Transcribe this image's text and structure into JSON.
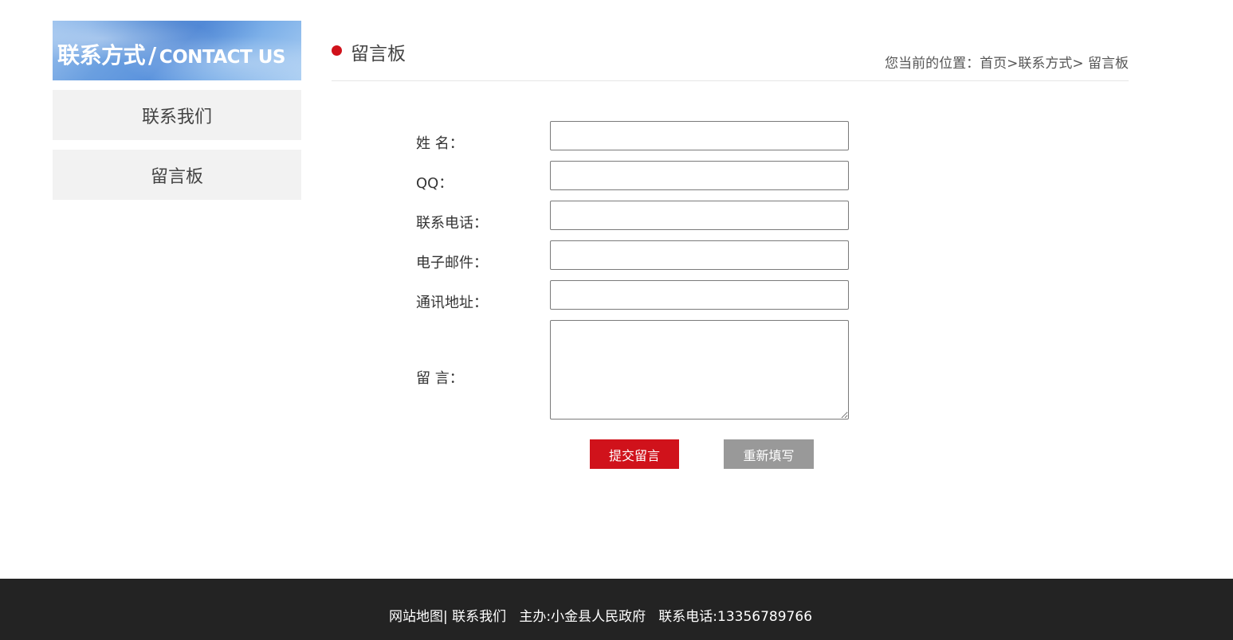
{
  "sidebar": {
    "banner_cn": "联系方式",
    "banner_sep": "/",
    "banner_en": "CONTACT US",
    "items": [
      {
        "label": "联系我们"
      },
      {
        "label": "留言板"
      }
    ]
  },
  "header": {
    "title": "留言板",
    "breadcrumb_prefix": "您当前的位置：",
    "breadcrumb_home": "首页",
    "breadcrumb_sep1": ">",
    "breadcrumb_section": "联系方式",
    "breadcrumb_sep2": "> ",
    "breadcrumb_current": "留言板"
  },
  "form": {
    "name_label": "姓 名：",
    "name_value": "",
    "qq_label": "QQ：",
    "qq_value": "",
    "phone_label": "联系电话：",
    "phone_value": "",
    "email_label": "电子邮件：",
    "email_value": "",
    "address_label": "通讯地址：",
    "address_value": "",
    "message_label": "留 言：",
    "message_value": "",
    "submit_label": "提交留言",
    "reset_label": "重新填写"
  },
  "footer": {
    "sitemap": "网站地图",
    "sep": "| ",
    "contact": "联系我们",
    "sponsor": "   主办:小金县人民政府",
    "phone": "   联系电话:13356789766"
  },
  "colors": {
    "accent_red": "#d0121b",
    "reset_gray": "#999999",
    "footer_bg": "#232323",
    "sidebar_item_bg": "#f2f2f2"
  }
}
